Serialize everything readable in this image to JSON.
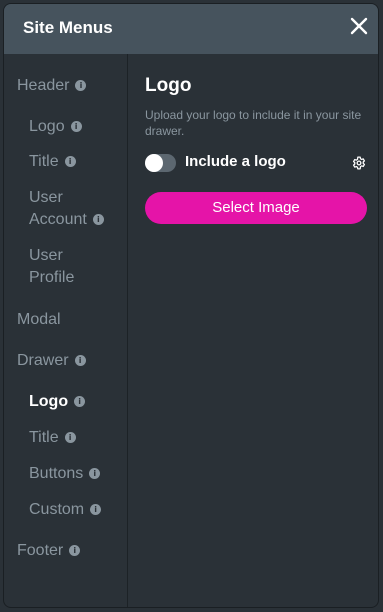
{
  "panel": {
    "title": "Site Menus"
  },
  "sidebar": {
    "items": [
      {
        "label": "Header",
        "info": "i"
      },
      {
        "label": "Logo",
        "info": "i"
      },
      {
        "label": "Title",
        "info": "i"
      },
      {
        "label_line1": "User",
        "label_line2": "Account",
        "info": "i"
      },
      {
        "label_line1": "User",
        "label_line2": "Profile"
      },
      {
        "label": "Modal"
      },
      {
        "label": "Drawer",
        "info": "i"
      },
      {
        "label": "Logo",
        "info": "i",
        "active": true
      },
      {
        "label": "Title",
        "info": "i"
      },
      {
        "label": "Buttons",
        "info": "i"
      },
      {
        "label": "Custom",
        "info": "i"
      },
      {
        "label": "Footer",
        "info": "i"
      }
    ]
  },
  "content": {
    "heading": "Logo",
    "description": "Upload your logo to include it in your site drawer.",
    "toggle_label": "Include a logo",
    "toggle_on": false,
    "select_button": "Select Image"
  },
  "colors": {
    "accent": "#e514a8",
    "header_bg": "#46535d",
    "panel_bg": "#2a3137"
  },
  "icons": {
    "close": "close-icon",
    "settings": "gear-icon",
    "info": "info-icon"
  }
}
